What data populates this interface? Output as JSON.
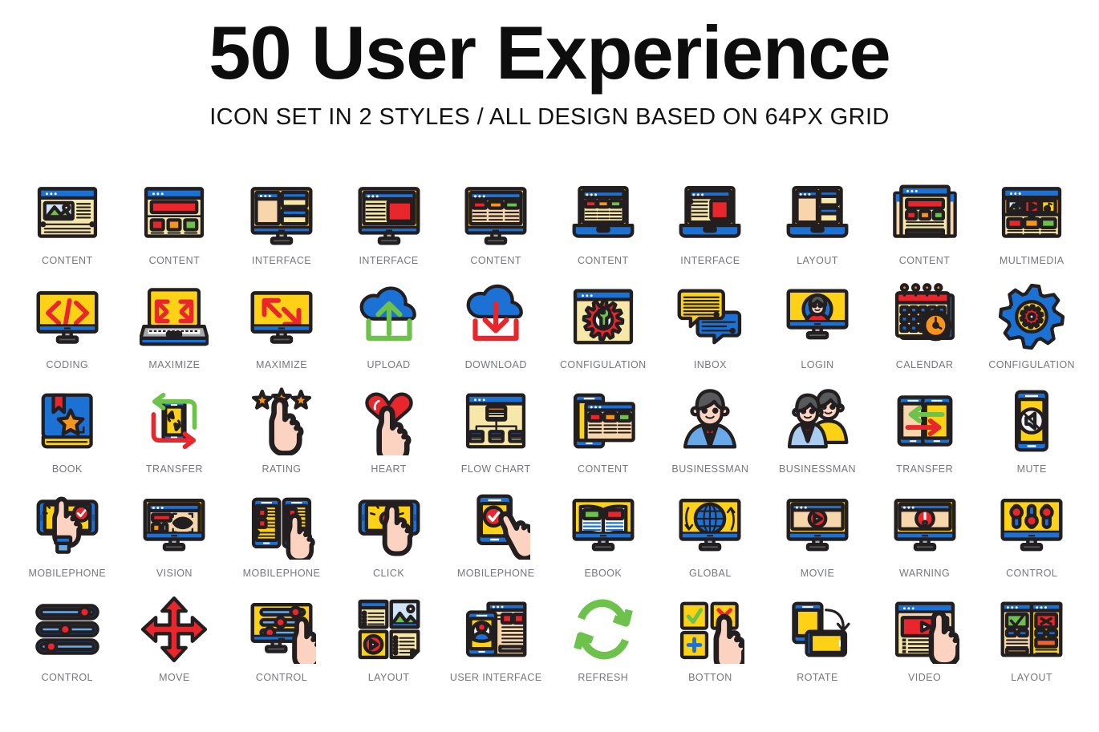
{
  "header": {
    "title": "50 User Experience",
    "subtitle": "ICON SET IN 2 STYLES  /  ALL DESIGN BASED ON 64PX GRID"
  },
  "palette": {
    "outline": "#231f20",
    "blue": "#1c72d4",
    "blue_dark": "#1559ad",
    "yellow": "#fcd116",
    "cream": "#f7e7a8",
    "peach": "#f7d6ac",
    "red": "#e8262c",
    "green": "#6cc24a",
    "orange": "#f7941e",
    "grey": "#58595b",
    "grey_light": "#a7a9ac",
    "skin": "#fbd3c0",
    "label_text": "#76777a",
    "background": "#ffffff"
  },
  "grid": {
    "columns": 10,
    "rows": 5,
    "total_icons": 50
  },
  "icons": [
    {
      "label": "CONTENT",
      "glyph": "browser-article-image"
    },
    {
      "label": "CONTENT",
      "glyph": "browser-banner-cards"
    },
    {
      "label": "INTERFACE",
      "glyph": "monitor-panels-layout"
    },
    {
      "label": "INTERFACE",
      "glyph": "monitor-text-image"
    },
    {
      "label": "CONTENT",
      "glyph": "monitor-three-cards"
    },
    {
      "label": "CONTENT",
      "glyph": "laptop-three-cards"
    },
    {
      "label": "INTERFACE",
      "glyph": "laptop-text-image"
    },
    {
      "label": "LAYOUT",
      "glyph": "laptop-split-panels"
    },
    {
      "label": "CONTENT",
      "glyph": "stacked-windows-cards"
    },
    {
      "label": "MULTIMEDIA",
      "glyph": "browser-media-tiles"
    },
    {
      "label": "CODING",
      "glyph": "monitor-code-brackets"
    },
    {
      "label": "MAXIMIZE",
      "glyph": "laptop-expand-arrows"
    },
    {
      "label": "MAXIMIZE",
      "glyph": "monitor-diagonal-arrows"
    },
    {
      "label": "UPLOAD",
      "glyph": "cloud-upload"
    },
    {
      "label": "DOWNLOAD",
      "glyph": "cloud-download"
    },
    {
      "label": "CONFIGULATION",
      "glyph": "browser-gear-wrench"
    },
    {
      "label": "INBOX",
      "glyph": "chat-bubbles"
    },
    {
      "label": "LOGIN",
      "glyph": "monitor-user-avatar"
    },
    {
      "label": "CALENDAR",
      "glyph": "calendar-clock"
    },
    {
      "label": "CONFIGULATION",
      "glyph": "double-gear"
    },
    {
      "label": "BOOK",
      "glyph": "book-star-bookmark"
    },
    {
      "label": "TRANSFER",
      "glyph": "phone-sync-arrows"
    },
    {
      "label": "RATING",
      "glyph": "three-stars-hand"
    },
    {
      "label": "HEART",
      "glyph": "heart-hand"
    },
    {
      "label": "FLOW CHART",
      "glyph": "browser-flowchart"
    },
    {
      "label": "CONTENT",
      "glyph": "phone-browser-cards"
    },
    {
      "label": "BUSINESSMAN",
      "glyph": "businessman-single"
    },
    {
      "label": "BUSINESSMAN",
      "glyph": "businessman-pair"
    },
    {
      "label": "TRANSFER",
      "glyph": "two-phones-arrows"
    },
    {
      "label": "MUTE",
      "glyph": "phone-mute-speaker"
    },
    {
      "label": "MOBILEPHONE",
      "glyph": "tablet-tap-check"
    },
    {
      "label": "VISION",
      "glyph": "monitor-eye-focus"
    },
    {
      "label": "MOBILEPHONE",
      "glyph": "two-phones-tap"
    },
    {
      "label": "CLICK",
      "glyph": "tablet-click-button"
    },
    {
      "label": "MOBILEPHONE",
      "glyph": "phone-check-hand"
    },
    {
      "label": "EBOOK",
      "glyph": "monitor-open-book"
    },
    {
      "label": "GLOBAL",
      "glyph": "monitor-globe"
    },
    {
      "label": "MOVIE",
      "glyph": "monitor-play-button"
    },
    {
      "label": "WARNING",
      "glyph": "monitor-exclamation"
    },
    {
      "label": "CONTROL",
      "glyph": "monitor-sliders"
    },
    {
      "label": "CONTROL",
      "glyph": "three-slider-bars"
    },
    {
      "label": "MOVE",
      "glyph": "four-way-arrows"
    },
    {
      "label": "CONTROL",
      "glyph": "monitor-sliders-hand"
    },
    {
      "label": "LAYOUT",
      "glyph": "four-content-tiles"
    },
    {
      "label": "USER INTERFACE",
      "glyph": "phone-page-overlap"
    },
    {
      "label": "REFRESH",
      "glyph": "circular-refresh"
    },
    {
      "label": "BOTTON",
      "glyph": "button-tiles-hand"
    },
    {
      "label": "ROTATE",
      "glyph": "phone-rotate"
    },
    {
      "label": "VIDEO",
      "glyph": "browser-video-hand"
    },
    {
      "label": "LAYOUT",
      "glyph": "two-column-compare"
    }
  ]
}
